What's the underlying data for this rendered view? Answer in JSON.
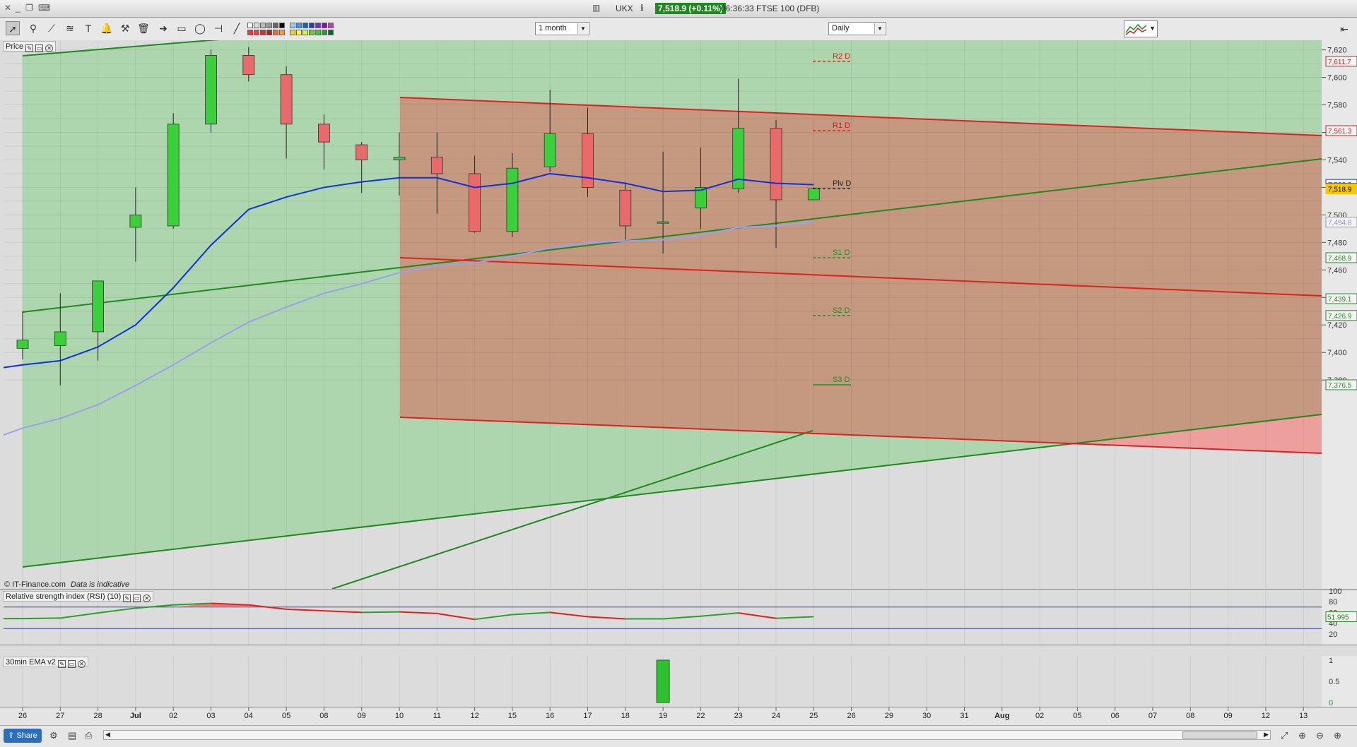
{
  "window": {
    "symbol": "UKX",
    "price_badge": "7,518.9 (+0.11%)",
    "time_instrument": "06:36:33 FTSE 100 (DFB)"
  },
  "toolbar": {
    "period_select": "1 month",
    "interval_select": "Daily"
  },
  "panels": {
    "price_label": "Price",
    "rsi_label": "Relative strength index (RSI) (10)",
    "ema_label": "30min EMA v2",
    "copyright": "© IT-Finance.com",
    "disclaimer": "Data is indicative"
  },
  "price_axis": {
    "ticks": [
      "7,620",
      "7,600",
      "7,580",
      "7,560",
      "7,540",
      "7,520",
      "7,500",
      "7,480",
      "7,460",
      "7,440",
      "7,420",
      "7,400",
      "7,380"
    ],
    "markers": [
      {
        "text": "7,611.7",
        "value": 7611.7,
        "color": "#d02020"
      },
      {
        "text": "7,561.3",
        "value": 7561.3,
        "color": "#d02020"
      },
      {
        "text": "7,522.2",
        "value": 7522.2,
        "color": "#2040d0"
      },
      {
        "text": "7,519.3",
        "value": 7519.3,
        "color": "#333333"
      },
      {
        "text": "7,518.9",
        "value": 7518.9,
        "color": "#f5c800"
      },
      {
        "text": "7,494.8",
        "value": 7494.8,
        "color": "#9090d8"
      },
      {
        "text": "7,468.9",
        "value": 7468.9,
        "color": "#2a8a2a"
      },
      {
        "text": "7,439.1",
        "value": 7439.1,
        "color": "#2a8a2a"
      },
      {
        "text": "7,426.9",
        "value": 7426.9,
        "color": "#2a8a2a"
      },
      {
        "text": "7,376.5",
        "value": 7376.5,
        "color": "#2a8a2a"
      }
    ]
  },
  "rsi_axis": {
    "ticks": [
      "100",
      "80",
      "60",
      "40",
      "20"
    ],
    "current": "51.995"
  },
  "ema_axis": {
    "ticks": [
      "1",
      "0.5",
      "0"
    ]
  },
  "pivots": [
    {
      "label": "R2 D",
      "value": 7611.7,
      "color": "#d02020"
    },
    {
      "label": "R1 D",
      "value": 7561.3,
      "color": "#d02020"
    },
    {
      "label": "Piv D",
      "value": 7519.3,
      "color": "#222222"
    },
    {
      "label": "S1 D",
      "value": 7468.9,
      "color": "#2a8a2a"
    },
    {
      "label": "S2 D",
      "value": 7426.9,
      "color": "#2a8a2a"
    },
    {
      "label": "S3 D",
      "value": 7376.5,
      "color": "#2a8a2a"
    }
  ],
  "x_axis": {
    "labels": [
      "26",
      "27",
      "28",
      "Jul",
      "02",
      "03",
      "04",
      "05",
      "08",
      "09",
      "10",
      "11",
      "12",
      "15",
      "16",
      "17",
      "18",
      "19",
      "22",
      "23",
      "24",
      "25",
      "26",
      "29",
      "30",
      "31",
      "Aug",
      "02",
      "05",
      "06",
      "07",
      "08",
      "09",
      "12",
      "13"
    ]
  },
  "chart_data": {
    "type": "candlestick",
    "instrument": "FTSE 100 (DFB)",
    "interval": "Daily",
    "ylim": [
      7370,
      7627
    ],
    "candles": [
      {
        "date": "26",
        "open": 7403,
        "high": 7430,
        "low": 7395,
        "close": 7409
      },
      {
        "date": "27",
        "open": 7405,
        "high": 7443,
        "low": 7376,
        "close": 7415
      },
      {
        "date": "28",
        "open": 7415,
        "high": 7452,
        "low": 7394,
        "close": 7452
      },
      {
        "date": "Jul",
        "open": 7491,
        "high": 7520,
        "low": 7466,
        "close": 7500
      },
      {
        "date": "02",
        "open": 7492,
        "high": 7574,
        "low": 7490,
        "close": 7566
      },
      {
        "date": "03",
        "open": 7566,
        "high": 7620,
        "low": 7560,
        "close": 7616
      },
      {
        "date": "04",
        "open": 7616,
        "high": 7622,
        "low": 7597,
        "close": 7602
      },
      {
        "date": "05",
        "open": 7602,
        "high": 7608,
        "low": 7541,
        "close": 7566
      },
      {
        "date": "08",
        "open": 7566,
        "high": 7573,
        "low": 7533,
        "close": 7553
      },
      {
        "date": "09",
        "open": 7551,
        "high": 7553,
        "low": 7516,
        "close": 7540
      },
      {
        "date": "10",
        "open": 7540,
        "high": 7560,
        "low": 7514,
        "close": 7542
      },
      {
        "date": "11",
        "open": 7542,
        "high": 7560,
        "low": 7501,
        "close": 7530
      },
      {
        "date": "12",
        "open": 7530,
        "high": 7543,
        "low": 7487,
        "close": 7488
      },
      {
        "date": "15",
        "open": 7488,
        "high": 7545,
        "low": 7484,
        "close": 7534
      },
      {
        "date": "16",
        "open": 7535,
        "high": 7591,
        "low": 7531,
        "close": 7559
      },
      {
        "date": "17",
        "open": 7559,
        "high": 7578,
        "low": 7513,
        "close": 7520
      },
      {
        "date": "18",
        "open": 7518,
        "high": 7524,
        "low": 7482,
        "close": 7492
      },
      {
        "date": "19",
        "open": 7494,
        "high": 7546,
        "low": 7472,
        "close": 7495
      },
      {
        "date": "22",
        "open": 7505,
        "high": 7549,
        "low": 7490,
        "close": 7520
      },
      {
        "date": "23",
        "open": 7519,
        "high": 7599,
        "low": 7516,
        "close": 7563
      },
      {
        "date": "24",
        "open": 7563,
        "high": 7569,
        "low": 7476,
        "close": 7511
      },
      {
        "date": "25",
        "open": 7511,
        "high": 7520,
        "low": 7511,
        "close": 7519
      }
    ],
    "ema_fast": [
      7391,
      7394,
      7404,
      7420,
      7447,
      7478,
      7504,
      7513,
      7520,
      7524,
      7527,
      7527,
      7520,
      7523,
      7530,
      7527,
      7523,
      7517,
      7518,
      7526,
      7523,
      7522
    ],
    "ema_slow": [
      7345,
      7352,
      7362,
      7376,
      7391,
      7407,
      7422,
      7433,
      7443,
      7450,
      7458,
      7463,
      7465,
      7470,
      7476,
      7480,
      7481,
      7482,
      7485,
      7491,
      7492,
      7495
    ],
    "rsi": [
      48.5,
      49.5,
      59,
      68,
      74,
      77,
      74,
      66,
      63,
      60,
      61,
      58,
      47,
      56,
      60,
      52,
      48,
      48,
      53,
      59,
      49,
      52
    ],
    "ema_signal": {
      "date": "19",
      "value": 1
    }
  }
}
